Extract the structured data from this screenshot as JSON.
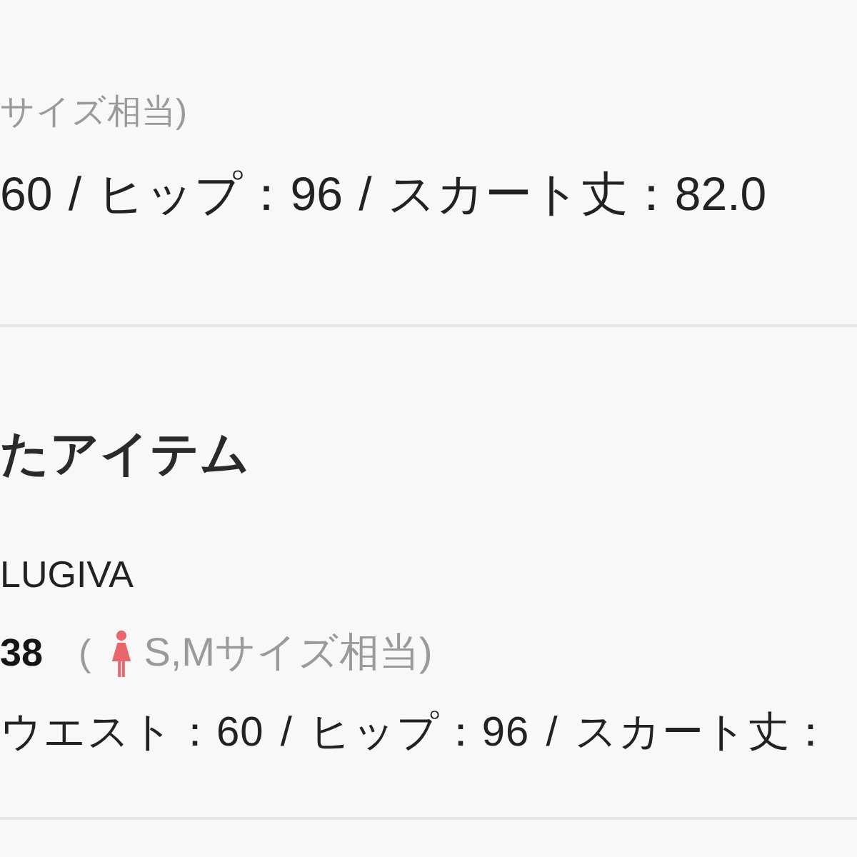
{
  "sections": [
    {
      "size_note": "サイズ相当)",
      "measurements": "60 / ヒップ：96 / スカート丈：82.0"
    },
    {
      "heading": "たアイテム",
      "brand": "LUGIVA",
      "size": "38",
      "paren": "(",
      "size_note": "S,Mサイズ相当)",
      "measurements": "ウエスト：60 / ヒップ：96 / スカート丈："
    }
  ]
}
